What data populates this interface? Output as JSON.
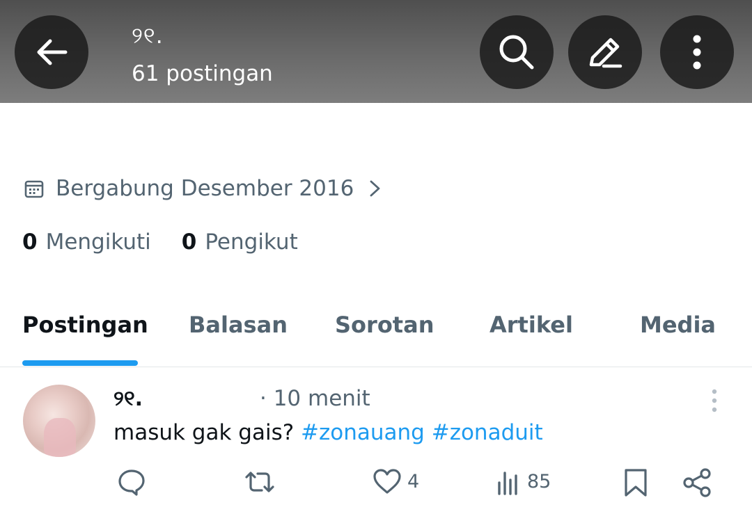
{
  "header": {
    "name": "୨୧.",
    "post_count": "61 postingan",
    "icons": [
      "arrow-left-icon",
      "search-icon",
      "pencil-icon",
      "more-vertical-icon"
    ]
  },
  "profile": {
    "joined": "Bergabung Desember 2016",
    "following_count": "0",
    "following_label": "Mengikuti",
    "followers_count": "0",
    "followers_label": "Pengikut"
  },
  "tabs": [
    {
      "label": "Postingan",
      "active": true
    },
    {
      "label": "Balasan",
      "active": false
    },
    {
      "label": "Sorotan",
      "active": false
    },
    {
      "label": "Artikel",
      "active": false
    },
    {
      "label": "Media",
      "active": false
    }
  ],
  "post": {
    "author": "୨୧.",
    "time": "· 10 menit",
    "text": "masuk gak gais? ",
    "hashtags": [
      "#zonauang",
      "#zonaduit"
    ],
    "likes": "4",
    "views": "85"
  },
  "colors": {
    "accent": "#1d9bf0",
    "muted_text": "#536471",
    "primary_text": "#0f1419"
  }
}
